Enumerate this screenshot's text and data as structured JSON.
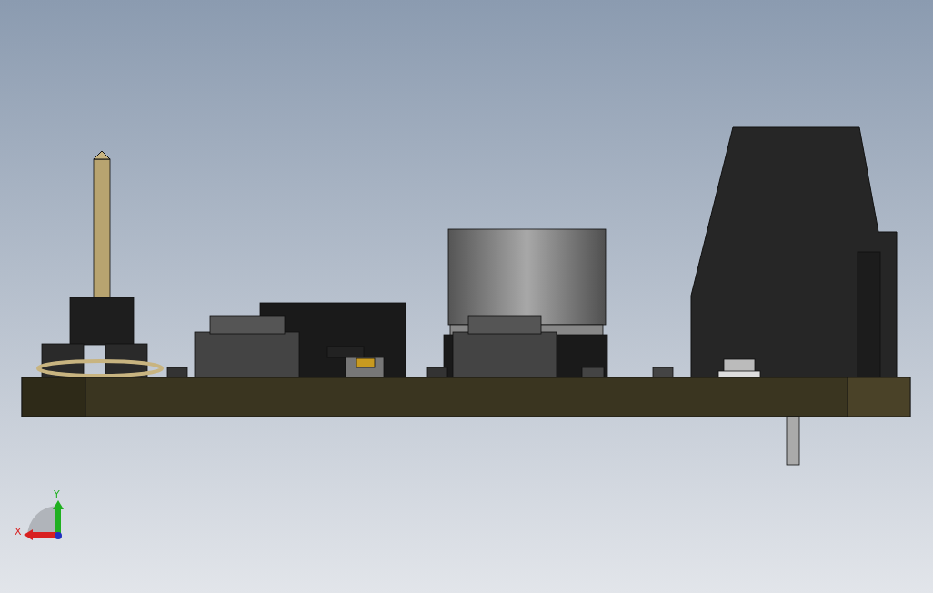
{
  "viewport": {
    "triad": {
      "axes": [
        {
          "label": "Y",
          "color": "#20b020"
        },
        {
          "label": "X",
          "color": "#d82020"
        }
      ]
    }
  }
}
